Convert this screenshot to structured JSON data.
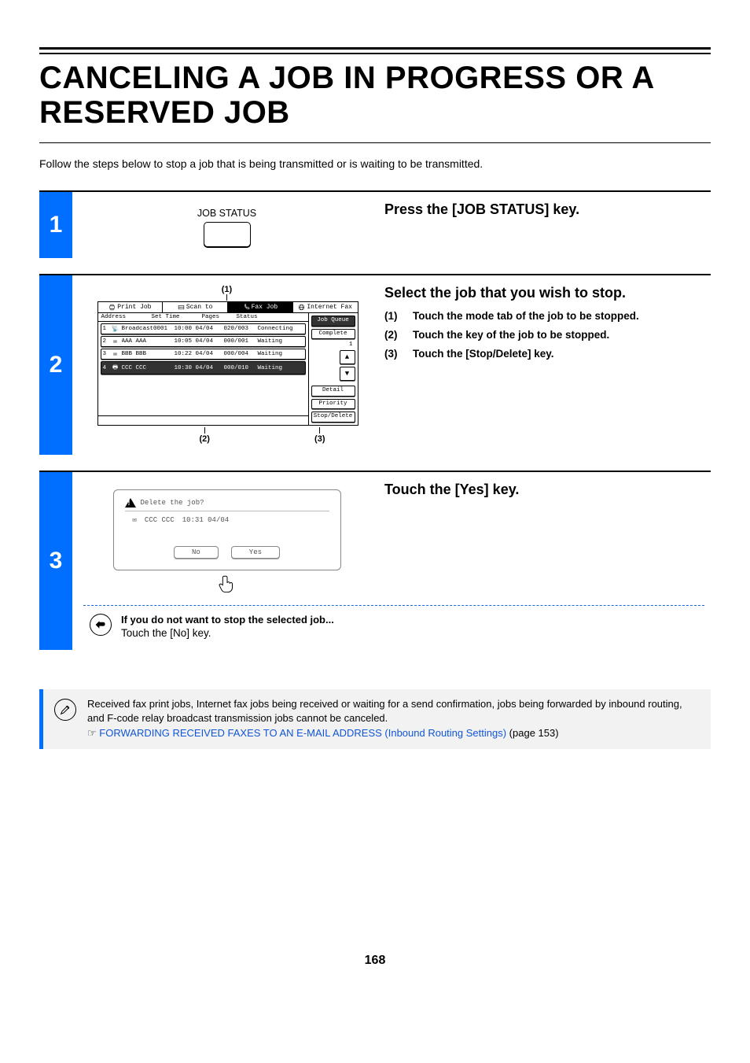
{
  "title": "CANCELING A JOB IN PROGRESS OR A RESERVED JOB",
  "intro": "Follow the steps below to stop a job that is being transmitted or is waiting to be transmitted.",
  "page_number": "168",
  "step1": {
    "num": "1",
    "key_label": "JOB STATUS",
    "heading": "Press the [JOB STATUS] key."
  },
  "step2": {
    "num": "2",
    "callout_top": "(1)",
    "callout_bl": "(2)",
    "callout_br": "(3)",
    "heading": "Select the job that you wish to stop.",
    "list": [
      {
        "marker": "(1)",
        "text": "Touch the mode tab of the job to be stopped."
      },
      {
        "marker": "(2)",
        "text": "Touch the key of the job to be stopped."
      },
      {
        "marker": "(3)",
        "text": "Touch the [Stop/Delete] key."
      }
    ],
    "tabs": {
      "print": "Print Job",
      "scan": "Scan to",
      "fax": "Fax Job",
      "ifax": "Internet Fax"
    },
    "columns": {
      "address": "Address",
      "set_time": "Set Time",
      "pages": "Pages",
      "status": "Status"
    },
    "rows": [
      {
        "idx": "1",
        "addr": "Broadcast0001",
        "time": "10:00 04/04",
        "pages": "020/003",
        "status": "Connecting",
        "selected": false,
        "icon": "📡"
      },
      {
        "idx": "2",
        "addr": "AAA AAA",
        "time": "10:05 04/04",
        "pages": "000/001",
        "status": "Waiting",
        "selected": false,
        "icon": "✉"
      },
      {
        "idx": "3",
        "addr": "BBB BBB",
        "time": "10:22 04/04",
        "pages": "000/004",
        "status": "Waiting",
        "selected": false,
        "icon": "✉"
      },
      {
        "idx": "4",
        "addr": "CCC CCC",
        "time": "10:30 04/04",
        "pages": "000/010",
        "status": "Waiting",
        "selected": true,
        "icon": "🖶"
      }
    ],
    "side": {
      "job_queue": "Job Queue",
      "complete": "Complete",
      "spool_count": "1",
      "detail": "Detail",
      "priority": "Priority",
      "stop_delete": "Stop/Delete"
    }
  },
  "step3": {
    "num": "3",
    "heading": "Touch the [Yes] key.",
    "dialog": {
      "question": "Delete the job?",
      "job_addr": "CCC CCC",
      "job_time": "10:31 04/04",
      "no": "No",
      "yes": "Yes"
    },
    "note_title": "If you do not want to stop the selected job...",
    "note_body": "Touch the [No] key."
  },
  "info": {
    "line1": "Received fax print jobs, Internet fax jobs being received or waiting for a send confirmation, jobs being forwarded by inbound routing, and F-code relay broadcast transmission jobs cannot be canceled.",
    "pointer": "☞",
    "link_text": "FORWARDING RECEIVED FAXES TO AN E-MAIL ADDRESS (Inbound Routing Settings)",
    "suffix": " (page 153)"
  }
}
